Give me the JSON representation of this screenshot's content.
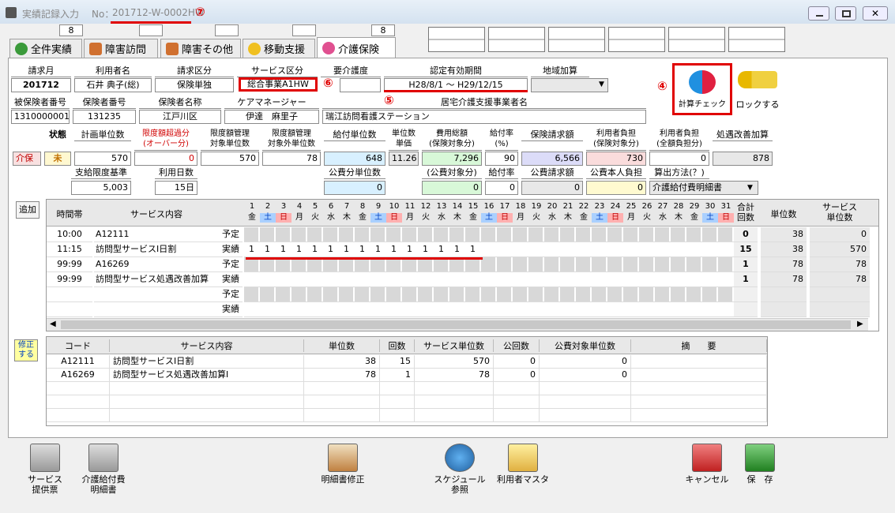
{
  "window": {
    "title": "実績記録入力",
    "no_label": "No：",
    "no_value": "201712-W-0002HW",
    "annotation": "⑦"
  },
  "top_counters": [
    "8",
    "",
    "",
    "",
    "8"
  ],
  "tabs": [
    "全件実績",
    "障害訪問",
    "障害その他",
    "移動支援",
    "介護保険"
  ],
  "header1": {
    "labels": [
      "請求月",
      "利用者名",
      "請求区分",
      "サービス区分",
      "要介護度",
      "認定有効期間",
      "地域加算"
    ],
    "values": [
      "201712",
      "石井 典子(総)",
      "保険単独",
      "総合事業A1HW",
      "",
      "H28/8/1 ～ H29/12/15",
      ""
    ],
    "ann6": "⑥",
    "ann5": "⑤",
    "ann4": "④"
  },
  "header2": {
    "labels": [
      "被保険者番号",
      "保険者番号",
      "保険者名称",
      "ケアマネージャー",
      "居宅介護支援事業者名"
    ],
    "values": [
      "1310000001",
      "131235",
      "江戸川区",
      "伊達　麻里子",
      "瑞江訪問看護ステーション"
    ]
  },
  "big_buttons": {
    "calc": "計算チェック",
    "lock": "ロックする"
  },
  "units": {
    "labels": [
      "状態",
      "計画単位数",
      "限度額超過分\n(オーバー分)",
      "限度額管理\n対象単位数",
      "限度額管理\n対象外単位数",
      "給付単位数",
      "単位数\n単価",
      "費用総額\n(保険対象分)",
      "給付率\n(%)",
      "保険請求額",
      "利用者負担\n(保険対象分)",
      "利用者負担\n(全額負担分)",
      "処遇改善加算"
    ],
    "row_label": "介保",
    "status": "未",
    "values": [
      "570",
      "0",
      "570",
      "78",
      "648",
      "11.26",
      "7,296",
      "90",
      "6,566",
      "730",
      "0",
      "878"
    ]
  },
  "units2": {
    "labels": [
      "支給限度基準",
      "利用日数",
      "公費分単位数",
      "(公費対象分)",
      "給付率",
      "公費請求額",
      "公費本人負担",
      "算出方法(？)"
    ],
    "values": [
      "5,003",
      "15日",
      "0",
      "0",
      "0",
      "0",
      "0",
      "介護給付費明細書"
    ]
  },
  "add_btn": "追加",
  "sched": {
    "headers": [
      "時間帯",
      "サービス内容"
    ],
    "days": [
      "1",
      "2",
      "3",
      "4",
      "5",
      "6",
      "7",
      "8",
      "9",
      "10",
      "11",
      "12",
      "13",
      "14",
      "15",
      "16",
      "17",
      "18",
      "19",
      "20",
      "21",
      "22",
      "23",
      "24",
      "25",
      "26",
      "27",
      "28",
      "29",
      "30",
      "31"
    ],
    "weekdays": [
      "金",
      "土",
      "日",
      "月",
      "火",
      "水",
      "木",
      "金",
      "土",
      "日",
      "月",
      "火",
      "水",
      "木",
      "金",
      "土",
      "日",
      "月",
      "火",
      "水",
      "木",
      "金",
      "土",
      "日",
      "月",
      "火",
      "水",
      "木",
      "金",
      "土",
      "日"
    ],
    "right_headers": [
      "合計\n回数",
      "単位数",
      "サービス\n単位数"
    ],
    "plan": "予定",
    "actual": "実績",
    "rows": [
      {
        "time": "10:00",
        "svc": "A12111",
        "t": "予定",
        "marks": "",
        "cnt": "0",
        "unit": "38",
        "svcunit": "0"
      },
      {
        "time": "11:15",
        "svc": "訪問型サービスⅠ日割",
        "t": "実績",
        "marks": "1 1 1 1 1 1 1 1 1 1 1 1 1 1 1",
        "cnt": "15",
        "unit": "38",
        "svcunit": "570"
      },
      {
        "time": "99:99",
        "svc": "A16269",
        "t": "予定",
        "marks": "",
        "cnt": "1",
        "unit": "78",
        "svcunit": "78"
      },
      {
        "time": "99:99",
        "svc": "訪問型サービス処遇改善加算",
        "t": "実績",
        "marks": "",
        "cnt": "1",
        "unit": "78",
        "svcunit": "78"
      },
      {
        "time": "",
        "svc": "",
        "t": "予定",
        "marks": "",
        "cnt": "",
        "unit": "",
        "svcunit": ""
      },
      {
        "time": "",
        "svc": "",
        "t": "実績",
        "marks": "",
        "cnt": "",
        "unit": "",
        "svcunit": ""
      }
    ]
  },
  "fix_btn": "修正\nする",
  "detail": {
    "headers": [
      "コード",
      "サービス内容",
      "単位数",
      "回数",
      "サービス単位数",
      "公回数",
      "公費対象単位数",
      "摘　　要"
    ],
    "rows": [
      [
        "A12111",
        "訪問型サービスⅠ日割",
        "38",
        "15",
        "570",
        "0",
        "0",
        ""
      ],
      [
        "A16269",
        "訪問型サービス処遇改善加算Ⅰ",
        "78",
        "1",
        "78",
        "0",
        "0",
        ""
      ]
    ]
  },
  "bottom": [
    "サービス\n提供票",
    "介護給付費\n明細書",
    "明細書修正",
    "スケジュール\n参照",
    "利用者マスタ",
    "キャンセル",
    "保　存"
  ]
}
